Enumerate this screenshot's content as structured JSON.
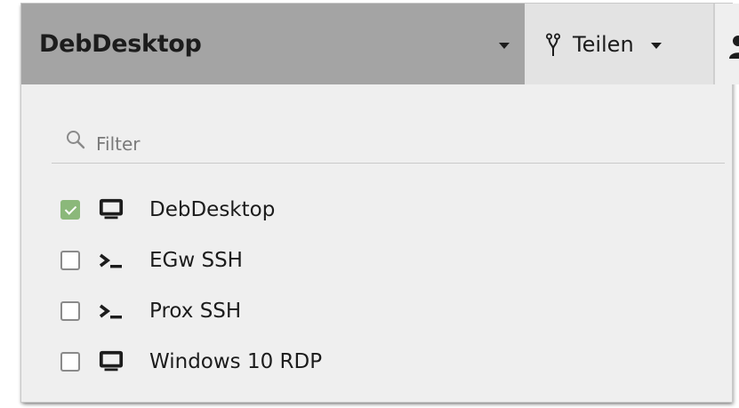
{
  "header": {
    "connection_title": "DebDesktop",
    "share_label": "Teilen"
  },
  "filter": {
    "placeholder": "Filter",
    "value": ""
  },
  "connections": [
    {
      "name": "DebDesktop",
      "icon": "desktop-icon",
      "checked": true
    },
    {
      "name": "EGw SSH",
      "icon": "terminal-icon",
      "checked": false
    },
    {
      "name": "Prox SSH",
      "icon": "terminal-icon",
      "checked": false
    },
    {
      "name": "Windows 10 RDP",
      "icon": "desktop-icon",
      "checked": false
    }
  ],
  "colors": {
    "header_bg": "#a4a4a4",
    "share_bg": "#e3e3e3",
    "panel_bg": "#efefef",
    "checked_bg": "#8bb87a"
  }
}
